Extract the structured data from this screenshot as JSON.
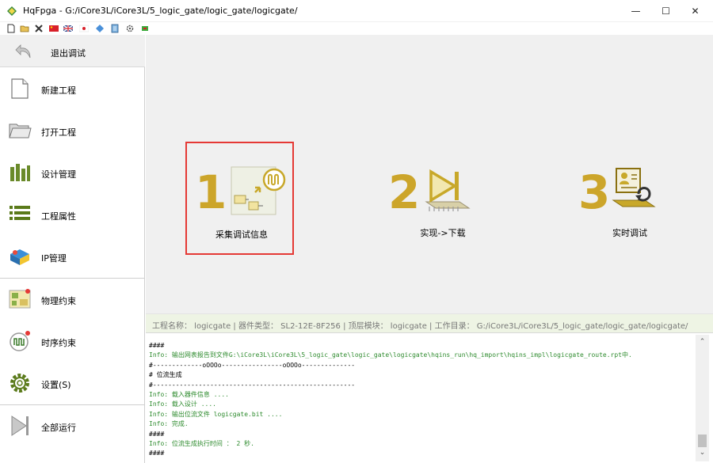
{
  "window": {
    "title": "HqFpga - G:/iCore3L/iCore3L/5_logic_gate/logic_gate/logicgate/",
    "minimize": "—",
    "maximize": "☐",
    "close": "✕"
  },
  "toolbar": {
    "icons": [
      "new-file-icon",
      "open-folder-icon",
      "close-x-icon",
      "chinese-flag-icon",
      "uk-flag-icon",
      "japan-flag-icon",
      "diamond-icon",
      "document-icon",
      "gear-small-icon",
      "chip-icon"
    ]
  },
  "sidebar": {
    "exit_label": "退出调试",
    "items": [
      {
        "label": "新建工程",
        "icon": "new-project-icon"
      },
      {
        "label": "打开工程",
        "icon": "open-project-icon"
      },
      {
        "label": "设计管理",
        "icon": "design-management-icon"
      },
      {
        "label": "工程属性",
        "icon": "project-properties-icon"
      },
      {
        "label": "IP管理",
        "icon": "ip-management-icon"
      },
      {
        "label": "物理约束",
        "icon": "physical-constraint-icon"
      },
      {
        "label": "时序约束",
        "icon": "timing-constraint-icon"
      },
      {
        "label": "设置(S)",
        "icon": "settings-gear-icon"
      },
      {
        "label": "全部运行",
        "icon": "run-all-icon"
      }
    ]
  },
  "steps": [
    {
      "number": "1",
      "label": "采集调试信息"
    },
    {
      "number": "2",
      "label": "实现->下载"
    },
    {
      "number": "3",
      "label": "实时调试"
    }
  ],
  "infobar": {
    "text": "工程名称： logicgate  |  器件类型： SL2-12E-8F256  |  顶层模块： logicgate  |  工作目录： G:/iCore3L/iCore3L/5_logic_gate/logic_gate/logicgate/"
  },
  "console": {
    "lines": [
      {
        "text": "####",
        "color": "black"
      },
      {
        "text": "Info: 输出网表报告到文件G:\\iCore3L\\iCore3L\\5_logic_gate\\logic_gate\\logicgate\\hqins_run\\hq_import\\hqins_impl\\logicgate_route.rpt中.",
        "color": "green"
      },
      {
        "text": "#-------------oOOOo----------------oOOOo--------------",
        "color": "black"
      },
      {
        "text": "# 位流生成",
        "color": "black"
      },
      {
        "text": "#-----------------------------------------------------",
        "color": "black"
      },
      {
        "text": "Info: 载入器件信息 ....",
        "color": "green"
      },
      {
        "text": "Info: 载入设计 ....",
        "color": "green"
      },
      {
        "text": "Info: 输出位流文件 logicgate.bit ....",
        "color": "green"
      },
      {
        "text": "Info: 完成.",
        "color": "green"
      },
      {
        "text": "####",
        "color": "black"
      },
      {
        "text": "Info: 位流生成执行时间 ： 2 秒.",
        "color": "green"
      },
      {
        "text": "####",
        "color": "black"
      }
    ]
  }
}
